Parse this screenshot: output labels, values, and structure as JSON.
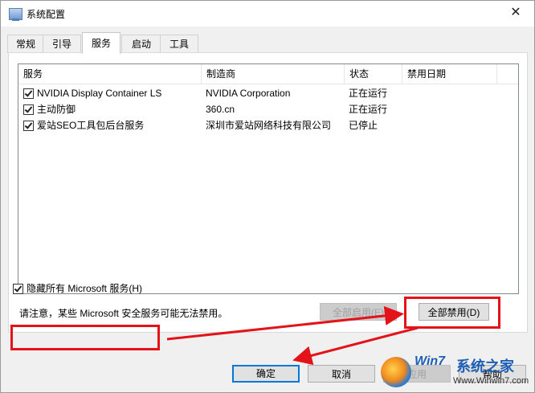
{
  "window": {
    "title": "系统配置",
    "close_glyph": "✕"
  },
  "tabs": [
    {
      "label": "常规"
    },
    {
      "label": "引导"
    },
    {
      "label": "服务"
    },
    {
      "label": "启动"
    },
    {
      "label": "工具"
    }
  ],
  "services": {
    "columns": [
      "服务",
      "制造商",
      "状态",
      "禁用日期"
    ],
    "rows": [
      {
        "checked": true,
        "name": "NVIDIA Display Container LS",
        "vendor": "NVIDIA Corporation",
        "status": "正在运行",
        "disabled_date": ""
      },
      {
        "checked": true,
        "name": "主动防御",
        "vendor": "360.cn",
        "status": "正在运行",
        "disabled_date": ""
      },
      {
        "checked": true,
        "name": "爱站SEO工具包后台服务",
        "vendor": "深圳市爱站网络科技有限公司",
        "status": "已停止",
        "disabled_date": ""
      }
    ]
  },
  "notice": "请注意，某些 Microsoft 安全服务可能无法禁用。",
  "buttons": {
    "enable_all": "全部启用(E)",
    "disable_all": "全部禁用(D)",
    "ok": "确定",
    "cancel": "取消",
    "apply": "应用",
    "help": "帮助"
  },
  "hide_microsoft": {
    "checked": true,
    "label": "隐藏所有 Microsoft 服务(H)"
  },
  "watermark": {
    "brand": "Win7",
    "brand_cn": "系统之家",
    "url": "Www.Winwin7.com"
  },
  "annotation_color": "#e3131a",
  "accent_color": "#0078d7"
}
